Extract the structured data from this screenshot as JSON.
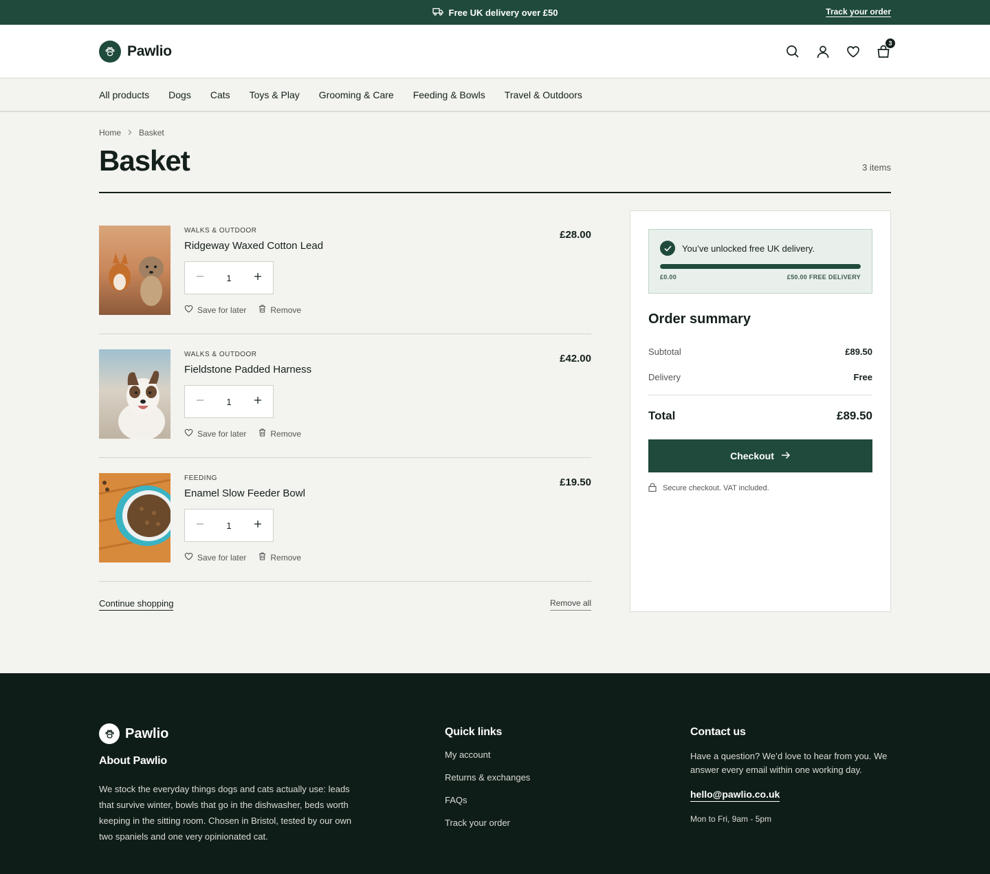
{
  "announcement": {
    "message": "Free UK delivery over £50",
    "track_link": "Track your order"
  },
  "header": {
    "brand": "Pawlio",
    "cart_count": "3"
  },
  "nav": {
    "items": [
      "All products",
      "Dogs",
      "Cats",
      "Toys & Play",
      "Grooming & Care",
      "Feeding & Bowls",
      "Travel & Outdoors"
    ]
  },
  "breadcrumb": {
    "home": "Home",
    "current": "Basket"
  },
  "page": {
    "title": "Basket",
    "item_count": "3 items"
  },
  "basket": {
    "items": [
      {
        "category": "WALKS & OUTDOOR",
        "name": "Ridgeway Waxed Cotton Lead",
        "price": "£28.00",
        "quantity": "1"
      },
      {
        "category": "WALKS & OUTDOOR",
        "name": "Fieldstone Padded Harness",
        "price": "£42.00",
        "quantity": "1"
      },
      {
        "category": "FEEDING",
        "name": "Enamel Slow Feeder Bowl",
        "price": "£19.50",
        "quantity": "1"
      }
    ],
    "save_label": "Save for later",
    "remove_label": "Remove",
    "continue_label": "Continue shopping",
    "remove_all_label": "Remove all"
  },
  "summary": {
    "delivery_message": "You’ve unlocked free UK delivery.",
    "progress_min": "£0.00",
    "progress_max": "£50.00 FREE DELIVERY",
    "progress_fraction": 1.0,
    "title": "Order summary",
    "subtotal_label": "Subtotal",
    "subtotal_value": "£89.50",
    "delivery_label": "Delivery",
    "delivery_value": "Free",
    "total_label": "Total",
    "total_value": "£89.50",
    "checkout_label": "Checkout",
    "secure_note": "Secure checkout. VAT included."
  },
  "footer": {
    "brand": "Pawlio",
    "about_heading": "About Pawlio",
    "about_text": "We stock the everyday things dogs and cats actually use: leads that survive winter, bowls that go in the dishwasher, beds worth keeping in the sitting room. Chosen in Bristol, tested by our own two spaniels and one very opinionated cat.",
    "quick_heading": "Quick links",
    "quick_links": [
      "My account",
      "Returns & exchanges",
      "FAQs",
      "Track your order"
    ],
    "contact_heading": "Contact us",
    "contact_text": "Have a question? We’d love to hear from you. We answer every email within one working day.",
    "email": "hello@pawlio.co.uk",
    "hours": "Mon to Fri, 9am - 5pm"
  },
  "colors": {
    "brand_green": "#1f4a3c",
    "footer_bg": "#0f1d18",
    "page_bg": "#f3f3ef"
  },
  "icons": [
    "truck-icon",
    "paw-icon",
    "search-icon",
    "user-icon",
    "heart-icon",
    "bag-icon",
    "chevron-right-icon",
    "minus-icon",
    "plus-icon",
    "trash-icon",
    "check-icon",
    "arrow-right-icon",
    "lock-icon"
  ]
}
